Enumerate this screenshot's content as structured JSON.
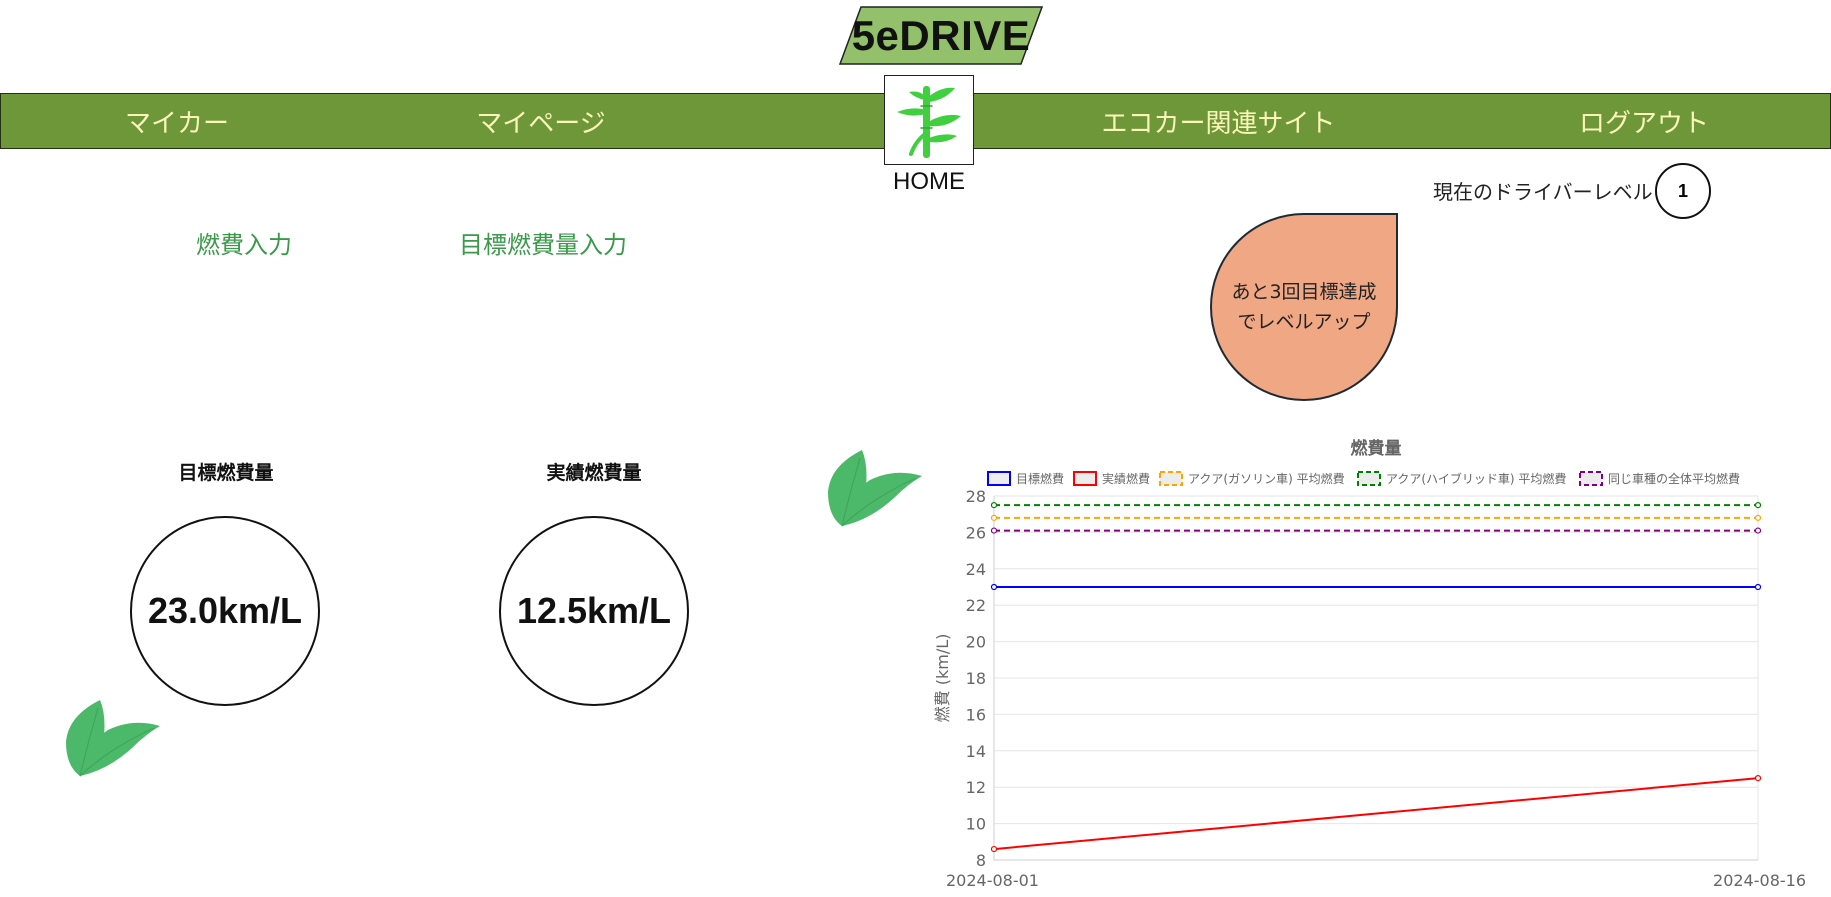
{
  "header": {
    "logo_text": "5eDRIVE"
  },
  "nav": {
    "items": [
      {
        "label": "マイカー"
      },
      {
        "label": "マイページ"
      },
      {
        "label": "エコカー関連サイト"
      },
      {
        "label": "ログアウト"
      }
    ],
    "home_label": "HOME"
  },
  "level": {
    "label": "現在のドライバーレベル",
    "value": "1"
  },
  "speech": {
    "line1": "あと3回目標達成",
    "line2": "でレベルアップ"
  },
  "links": {
    "fuel_input": "燃費入力",
    "target_input": "目標燃費量入力"
  },
  "stats": {
    "target": {
      "title": "目標燃費量",
      "value": "23.0km/L"
    },
    "actual": {
      "title": "実績燃費量",
      "value": "12.5km/L"
    }
  },
  "colors": {
    "nav_bg": "#6e973a",
    "nav_text": "#fbf6b8",
    "logo_bg": "#93c06a",
    "link_green": "#3a9a4a",
    "drop_fill": "#f0a884",
    "leaf_green": "#4cb96a"
  },
  "icons": [
    "bamboo-icon",
    "leaf-icon"
  ],
  "chart_data": {
    "type": "line",
    "title": "燃費量",
    "ylabel": "燃費 (km/L)",
    "xlabel": "",
    "x": [
      "2024-08-01",
      "2024-08-16"
    ],
    "ylim": [
      8,
      28
    ],
    "yticks": [
      8,
      10,
      12,
      14,
      16,
      18,
      20,
      22,
      24,
      26,
      28
    ],
    "grid": true,
    "legend_position": "top",
    "series": [
      {
        "name": "目標燃費",
        "values": [
          23,
          23
        ],
        "color": "#0000ff",
        "dashed": false
      },
      {
        "name": "実績燃費",
        "values": [
          8.6,
          12.5
        ],
        "color": "#ff0000",
        "dashed": false
      },
      {
        "name": "アクア(ガソリン車) 平均燃費",
        "values": [
          26.8,
          26.8
        ],
        "color": "#ffa500",
        "dashed": true
      },
      {
        "name": "アクア(ハイブリッド車) 平均燃費",
        "values": [
          27.5,
          27.5
        ],
        "color": "#008000",
        "dashed": true
      },
      {
        "name": "同じ車種の全体平均燃費",
        "values": [
          26.1,
          26.1
        ],
        "color": "#800080",
        "dashed": true
      }
    ]
  }
}
